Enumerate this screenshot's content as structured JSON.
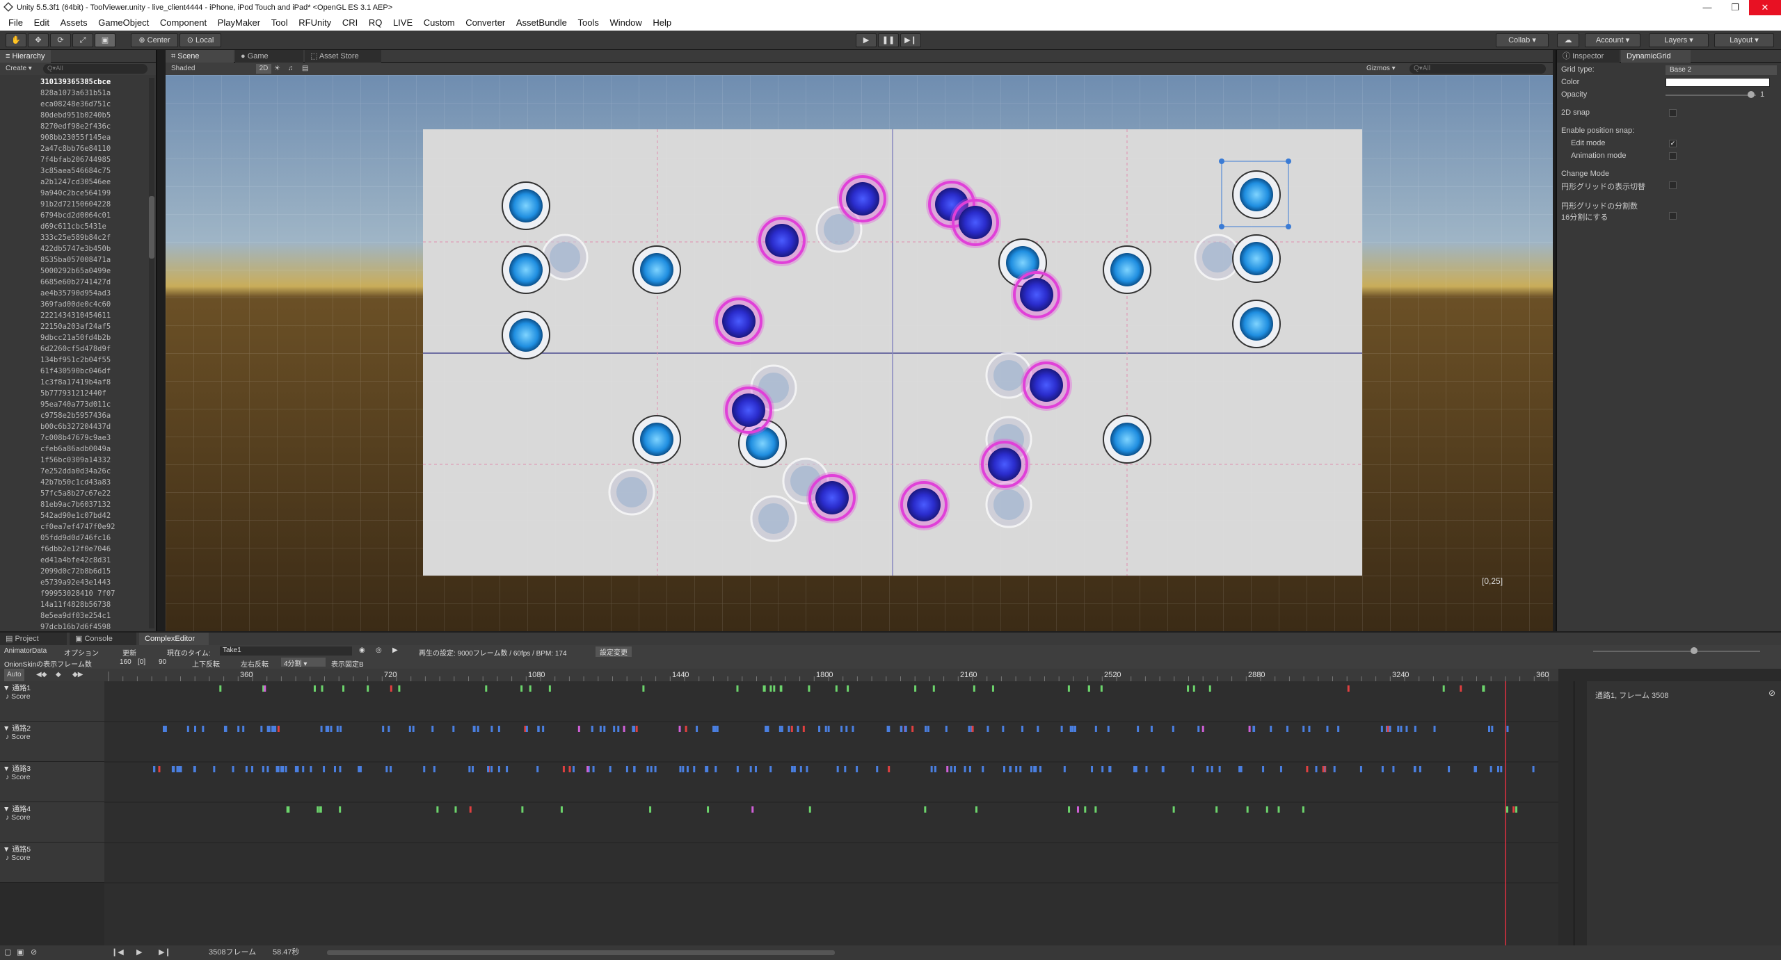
{
  "window": {
    "title": "Unity 5.5.3f1 (64bit) - ToolViewer.unity - live_client4444 - iPhone, iPod Touch and iPad* <OpenGL ES 3.1 AEP>"
  },
  "menu": [
    "File",
    "Edit",
    "Assets",
    "GameObject",
    "Component",
    "PlayMaker",
    "Tool",
    "RFUnity",
    "CRI",
    "RQ",
    "LIVE",
    "Custom",
    "Converter",
    "AssetBundle",
    "Tools",
    "Window",
    "Help"
  ],
  "toolbar": {
    "pivot": "Center",
    "space": "Local",
    "collab": "Collab ▾",
    "account": "Account ▾",
    "layers": "Layers ▾",
    "layout": "Layout ▾"
  },
  "hierarchy": {
    "tab": "Hierarchy",
    "create": "Create ▾",
    "search_placeholder": "Q▾All",
    "items": [
      "310139365385cbce",
      "828a1073a631b51a",
      "eca08248e36d751c",
      "80debd951b0240b5",
      "8270edf98e2f436c",
      "908bb23055f145ea",
      "2a47c8bb76e84110",
      "7f4bfab206744985",
      "3c85aea546684c75",
      "a2b1247cd30546ee",
      "9a940c2bce564199",
      "91b2d72150604228",
      "6794bcd2d0064c01",
      "d69c611cbc5431e",
      "333c25e589b84c2f",
      "422db5747e3b450b",
      "8535ba057008471a",
      "5000292b65a0499e",
      "6685e60b2741427d",
      "ae4b35790d954ad3",
      "369fad00de0c4c60",
      "2221434310454611",
      "22150a203af24af5",
      "9dbcc21a50fd4b2b",
      "6d2260cf5d478d9f",
      "134bf951c2b04f55",
      "61f430590bc046df",
      "1c3f8a17419b4af8",
      "5b777931212440f",
      "95ea740a773d011c",
      "c9758e2b5957436a",
      "b00c6b327204437d",
      "7c008b47679c9ae3",
      "cfeb6a86adb0049a",
      "1f56bc0309a14332",
      "7e252dda0d34a26c",
      "42b7b50c1cd43a83",
      "57fc5a8b27c67e22",
      "81eb9ac7b6037132",
      "542ad90e1c07bd42",
      "cf0ea7ef4747f0e92",
      "05fdd9d0d746fc16",
      "f6dbb2e12f0e7046",
      "ed41a4bfe42c8d31",
      "2099d0c72b8b6d15",
      "e5739a92e43e1443",
      "f99953028410 7f07",
      "14a11f4828b56738",
      "8e5ea9df03e254c1",
      "97dcb16b7d6f4598"
    ]
  },
  "scene": {
    "tabs": [
      "Scene",
      "Game",
      "Asset Store"
    ],
    "shading": "Shaded",
    "mode_2d": "2D",
    "gizmos": "Gizmos ▾",
    "search_placeholder": "Q▾All",
    "coord_label": "[0,25]"
  },
  "inspector": {
    "tabs": [
      "Inspector",
      "DynamicGrid"
    ],
    "grid_type_label": "Grid type:",
    "grid_type_value": "Base 2",
    "color_label": "Color",
    "opacity_label": "Opacity",
    "opacity_value": "1",
    "snap_2d": "2D snap",
    "enable_snap": "Enable position snap:",
    "edit_mode": "Edit mode",
    "animation_mode": "Animation mode",
    "change_mode": "Change Mode",
    "circle_toggle": "円形グリッドの表示切替",
    "circle_divisions": "円形グリッドの分割数",
    "sixteen": "16分割にする"
  },
  "bottom": {
    "tabs": [
      "Project",
      "Console",
      "ComplexEditor"
    ],
    "row1": [
      "AnimatorData",
      "オプション",
      "更新",
      "現在のタイム:",
      "Take1"
    ],
    "info": "再生の設定: 9000フレーム数 / 60fps / BPM: 174",
    "settings_btn": "設定変更",
    "row2": [
      "OnionSkinの表示フレーム数",
      "160",
      "[0]",
      "90",
      "上下反転",
      "左右反転",
      "4分割 ▾",
      "表示固定B"
    ],
    "auto": "Auto",
    "ruler": [
      "360",
      "720",
      "1080",
      "1440",
      "1800",
      "2160",
      "2520",
      "2880",
      "3240",
      "360"
    ],
    "tracks": [
      {
        "name": "通路1",
        "sub": "Score"
      },
      {
        "name": "通路2",
        "sub": "Score"
      },
      {
        "name": "通路3",
        "sub": "Score"
      },
      {
        "name": "通路4",
        "sub": "Score"
      },
      {
        "name": "通路5",
        "sub": "Score"
      }
    ],
    "right_info": "通路1, フレーム 3508",
    "status_frames": "3508フレーム",
    "status_time": "58.47秒"
  }
}
